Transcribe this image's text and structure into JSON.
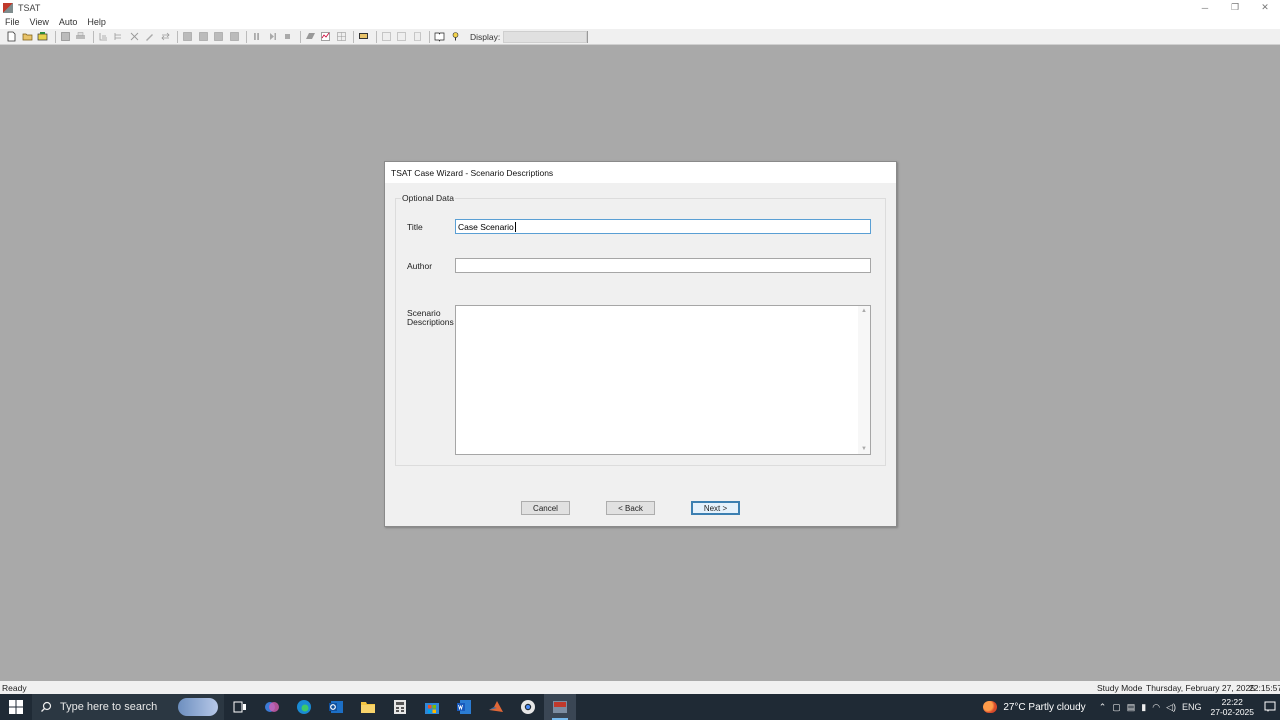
{
  "window": {
    "title": "TSAT",
    "minimize": "─",
    "maximize": "❐",
    "close": "✕"
  },
  "menu": [
    "File",
    "View",
    "Auto",
    "Help"
  ],
  "toolbar": {
    "display_label": "Display:"
  },
  "dialog": {
    "title": "TSAT Case Wizard - Scenario Descriptions",
    "group_label": "Optional Data",
    "title_label": "Title",
    "title_value": "Case Scenario",
    "author_label": "Author",
    "author_value": "",
    "desc_label_1": "Scenario",
    "desc_label_2": "Descriptions",
    "desc_value": "",
    "cancel": "Cancel",
    "back": "< Back",
    "next": "Next >"
  },
  "statusbar": {
    "left": "Ready",
    "mode": "Study Mode",
    "date": "Thursday, February 27, 2025",
    "time": "22:15:57"
  },
  "taskbar": {
    "search_placeholder": "Type here to search",
    "weather": "27°C  Partly cloudy",
    "language": "ENG",
    "clock_time": "22:22",
    "clock_date": "27-02-2025"
  },
  "colors": {
    "desktop": "#a9a9a9",
    "taskbar": "#1f2a35",
    "focus_border": "#5a9fd4"
  }
}
